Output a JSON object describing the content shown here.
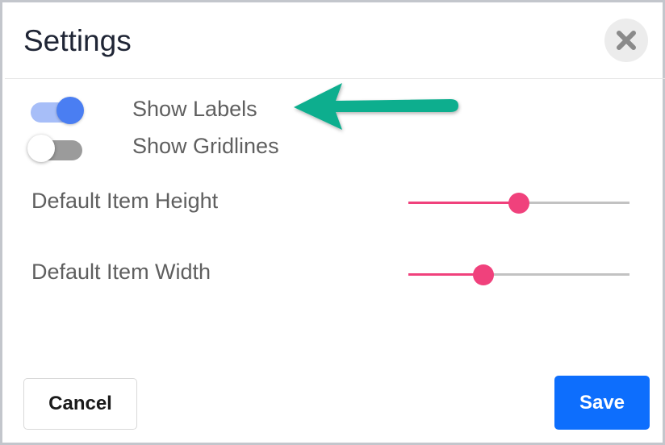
{
  "dialog": {
    "title": "Settings",
    "close_icon": "close-icon"
  },
  "toggles": [
    {
      "label": "Show Labels",
      "checked": true
    },
    {
      "label": "Show Gridlines",
      "checked": false
    }
  ],
  "sliders": [
    {
      "label": "Default Item Height",
      "value_fraction": 0.5
    },
    {
      "label": "Default Item Width",
      "value_fraction": 0.34
    }
  ],
  "annotation": {
    "icon": "arrow-left-icon",
    "color": "#0fae8e"
  },
  "buttons": {
    "cancel_label": "Cancel",
    "save_label": "Save"
  },
  "colors": {
    "toggle_on": "#4a7ef2",
    "slider_accent": "#f0417c",
    "primary_button": "#0d6efd"
  }
}
